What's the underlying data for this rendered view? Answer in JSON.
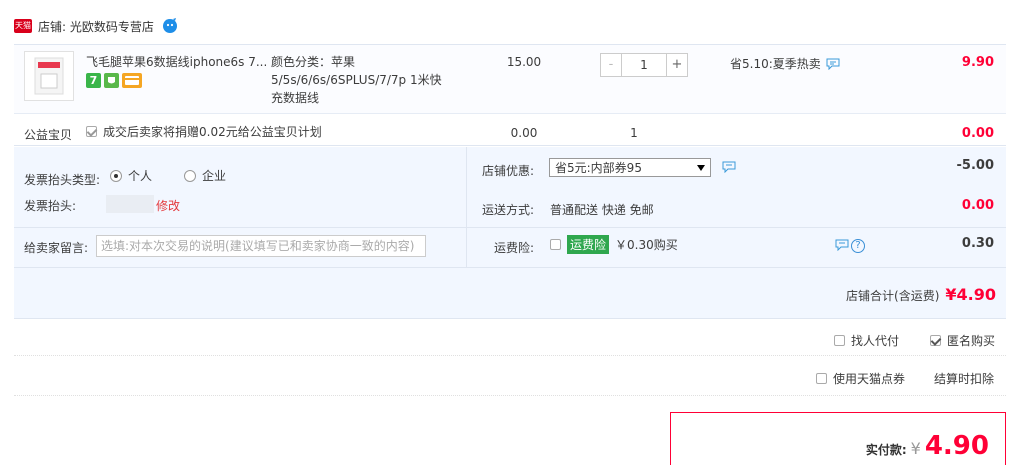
{
  "shop": {
    "badge": "天猫",
    "label": "店铺: 光欧数码专营店"
  },
  "item": {
    "title": "飞毛腿苹果6数据线iphone6s 7...",
    "sku": "颜色分类：苹果5/5s/6/6s/6SPLUS/7/7p 1米快充数据线",
    "price": "15.00",
    "quantity": "1",
    "minus": "-",
    "plus": "+",
    "promo": "省5.10:夏季热卖",
    "total": "9.90",
    "badge_7": "7"
  },
  "charity": {
    "label": "公益宝贝",
    "text": "成交后卖家将捐赠0.02元给公益宝贝计划",
    "price": "0.00",
    "qty": "1",
    "total": "0.00"
  },
  "invoice": {
    "type_label": "发票抬头类型:",
    "option_personal": "个人",
    "option_company": "企业",
    "title_label": "发票抬头:",
    "edit": "修改"
  },
  "message": {
    "label": "给卖家留言:",
    "placeholder": "选填:对本次交易的说明(建议填写已和卖家协商一致的内容)"
  },
  "discount": {
    "label": "店铺优惠:",
    "selected": "省5元:内部券95",
    "amount": "-5.00"
  },
  "shipping": {
    "label": "运送方式:",
    "value": "普通配送 快递 免邮",
    "amount": "0.00"
  },
  "insurance": {
    "label": "运费险:",
    "tag": "运费险",
    "text": "￥0.30购买",
    "amount": "0.30"
  },
  "shop_total": {
    "label": "店铺合计(含运费)",
    "amount": "¥4.90"
  },
  "options": {
    "proxy_pay": "找人代付",
    "anonymous": "匿名购买",
    "tmall_coupon": "使用天猫点券",
    "deduct": "结算时扣除"
  },
  "payment": {
    "label": "实付款:",
    "yen": "¥",
    "amount": "4.90"
  },
  "colors": {
    "accent": "#ff0036",
    "panel": "#f2f7ff",
    "tmall": "#d9001b"
  }
}
